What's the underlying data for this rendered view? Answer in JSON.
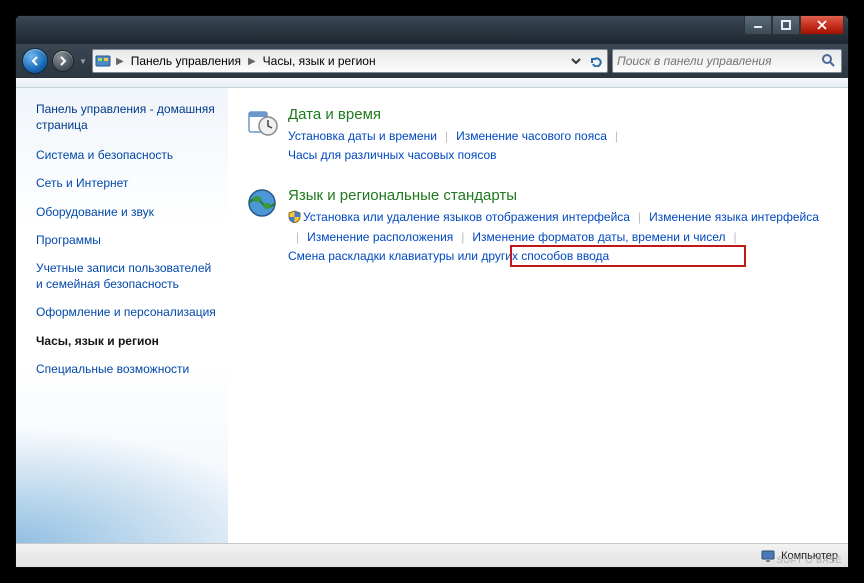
{
  "breadcrumb": {
    "root": "Панель управления",
    "section": "Часы, язык и регион"
  },
  "search": {
    "placeholder": "Поиск в панели управления"
  },
  "sidebar": {
    "home": "Панель управления - домашняя страница",
    "items": [
      {
        "label": "Система и безопасность"
      },
      {
        "label": "Сеть и Интернет"
      },
      {
        "label": "Оборудование и звук"
      },
      {
        "label": "Программы"
      },
      {
        "label": "Учетные записи пользователей и семейная безопасность"
      },
      {
        "label": "Оформление и персонализация"
      },
      {
        "label": "Часы, язык и регион",
        "active": true
      },
      {
        "label": "Специальные возможности"
      }
    ]
  },
  "categories": [
    {
      "title": "Дата и время",
      "icon": "clock-calendar-icon",
      "links": [
        "Установка даты и времени",
        "Изменение часового пояса",
        "Часы для различных часовых поясов"
      ]
    },
    {
      "title": "Язык и региональные стандарты",
      "icon": "globe-icon",
      "highlighted": true,
      "links": [
        "Установка или удаление языков отображения интерфейса",
        "Изменение языка интерфейса",
        "Изменение расположения",
        "Изменение форматов даты, времени и чисел",
        "Смена раскладки клавиатуры или других способов ввода"
      ],
      "shield_on_first": true
    }
  ],
  "status": {
    "label": "Компьютер"
  },
  "watermark": "SOFT O BASE"
}
